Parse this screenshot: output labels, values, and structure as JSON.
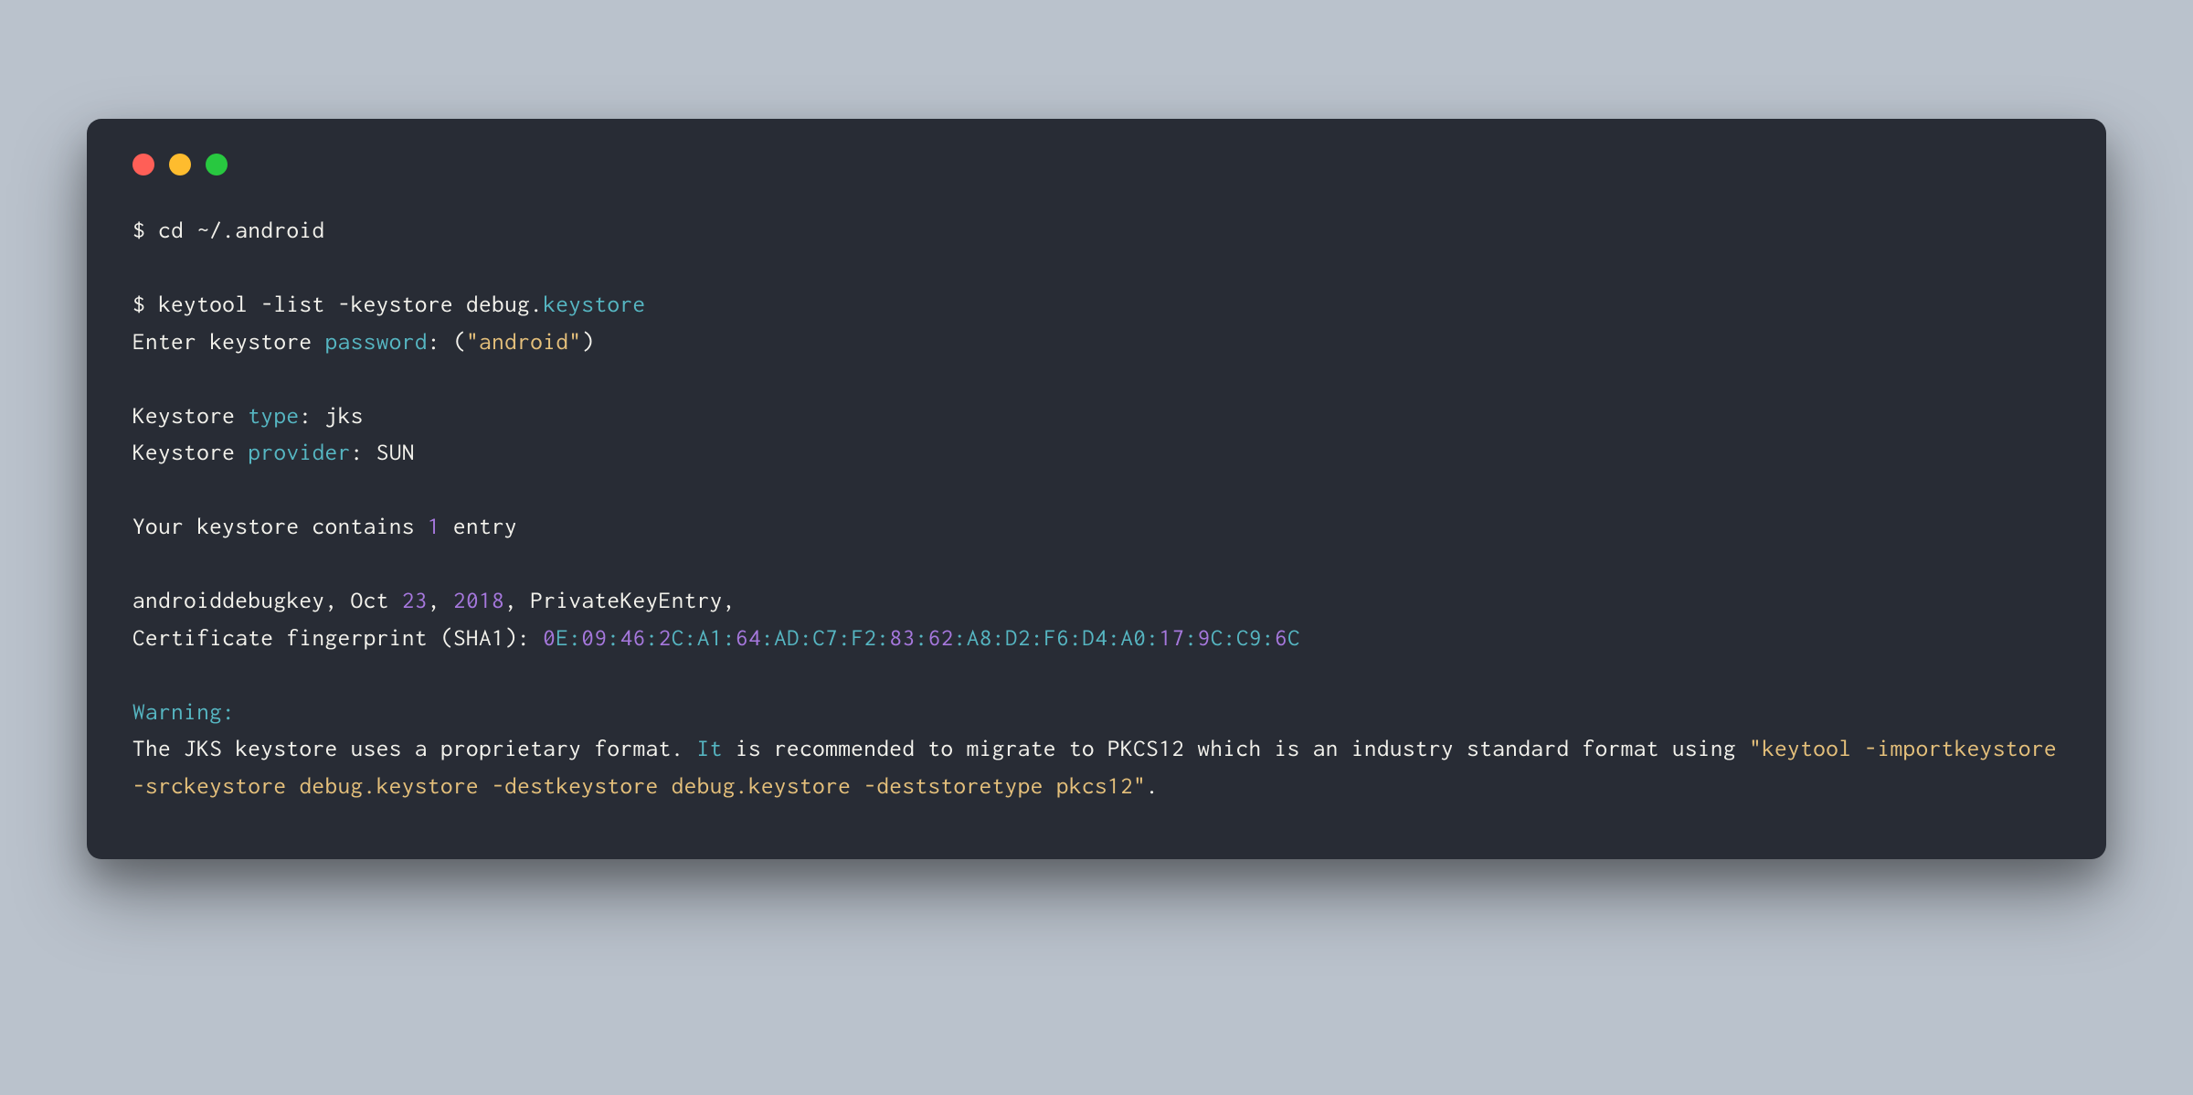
{
  "colors": {
    "background": "#bac2cc",
    "terminal_bg": "#282c35",
    "red": "#ff5f57",
    "yellow_light": "#febc2e",
    "green_light": "#28c840",
    "default": "#f3f2ec",
    "cyan": "#56b6c2",
    "yellow": "#e5c07b",
    "purple": "#a678dd"
  },
  "lines": {
    "l1_prompt": "$ cd ~/",
    "l1_path": ".android",
    "l2_prompt": "$ keytool -list -keystore debug.",
    "l2_keystore": "keystore",
    "l3_a": "Enter keystore ",
    "l3_password": "password",
    "l3_b": ": (",
    "l3_val": "\"android\"",
    "l3_c": ")",
    "l4_a": "Keystore ",
    "l4_type": "type",
    "l4_b": ": jks",
    "l5_a": "Keystore ",
    "l5_provider": "provider",
    "l5_b": ": SUN",
    "l6_a": "Your keystore contains ",
    "l6_num": "1",
    "l6_b": " entry",
    "l7_a": "androiddebugkey, Oct ",
    "l7_d": "23",
    "l7_b": ", ",
    "l7_y": "2018",
    "l7_c": ", PrivateKeyEntry, ",
    "l8_a": "Certificate fingerprint (SHA1): ",
    "fp_1": "0",
    "fp_2": "E",
    "fp_3": "09",
    "fp_4": "46",
    "fp_5": "2",
    "fp_6": "C",
    "fp_7": "A1",
    "fp_8": "64",
    "fp_9": "AD",
    "fp_10": "C7",
    "fp_11": "F2",
    "fp_12": "83",
    "fp_13": "62",
    "fp_14": "A8",
    "fp_15": "D2",
    "fp_16": "F6",
    "fp_17": "D4",
    "fp_18": "A0",
    "fp_19": "17",
    "fp_20": "9",
    "fp_21": "C",
    "fp_22": "C9",
    "fp_23": "6",
    "fp_24": "C",
    "colon": ":",
    "l9_warn": "Warning:",
    "l10_a": "The JKS keystore uses a proprietary format. ",
    "l10_it": "It",
    "l10_b": " is recommended to migrate to PKCS12 which is an industry standard format using ",
    "l10_cmd": "\"keytool -importkeystore -srckeystore debug.keystore -destkeystore debug.keystore -deststoretype pkcs12\"",
    "l10_c": "."
  }
}
